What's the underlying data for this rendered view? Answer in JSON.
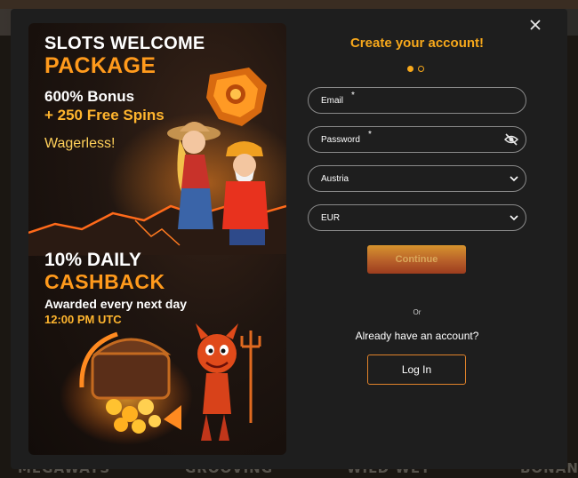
{
  "promo": {
    "headline_line1": "SLOTS WELCOME",
    "headline_line2": "PACKAGE",
    "bonus": "600% Bonus",
    "free_spins": "+ 250 Free Spins",
    "wagerless": "Wagerless!",
    "cashback_line1": "10% DAILY",
    "cashback_line2": "CASHBACK",
    "cashback_note": "Awarded every next day",
    "cashback_time": "12:00 PM UTC"
  },
  "form": {
    "title": "Create your account!",
    "steps": {
      "current": 1,
      "total": 2
    },
    "email": {
      "label": "Email",
      "required_mark": "*",
      "value": ""
    },
    "password": {
      "label": "Password",
      "required_mark": "*",
      "value": ""
    },
    "country": {
      "value": "Austria"
    },
    "currency": {
      "value": "EUR"
    },
    "continue_label": "Continue",
    "or_label": "Or",
    "already_text": "Already have an account?",
    "login_label": "Log In"
  },
  "background": {
    "words": [
      "MEGAWAYS",
      "GROOVING",
      "WILD WET",
      "BONANZA"
    ]
  },
  "icons": {
    "close": "close-icon",
    "eye": "eye-slash-icon",
    "chevron": "chevron-down-icon"
  },
  "colors": {
    "accent": "#f7a81b",
    "modal_bg": "#1e1e1e",
    "field_border": "#8a8a8a",
    "login_border": "#e0822a"
  }
}
